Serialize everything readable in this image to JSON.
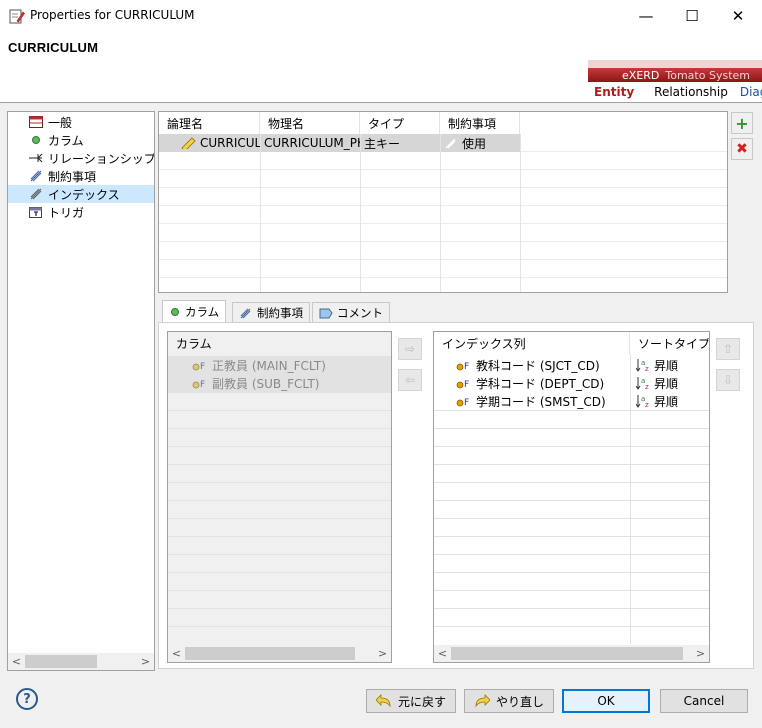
{
  "window": {
    "title": "Properties for CURRICULUM",
    "minimize": "—",
    "maximize": "☐",
    "close": "✕"
  },
  "header": {
    "entity_title": "CURRICULUM",
    "banner": {
      "brand": "eXERD",
      "subtitle": "Tomato System",
      "tabs": {
        "entity": "Entity",
        "relationship": "Relationship",
        "diagram": "Diag"
      }
    }
  },
  "tree": {
    "items": [
      {
        "label": "一般",
        "icon": "table-icon"
      },
      {
        "label": "カラム",
        "icon": "column-dot-icon"
      },
      {
        "label": "リレーションシップ",
        "icon": "relationship-arrow-icon"
      },
      {
        "label": "制約事項",
        "icon": "constraint-icon"
      },
      {
        "label": "インデックス",
        "icon": "index-icon",
        "selected": true
      },
      {
        "label": "トリガ",
        "icon": "trigger-icon"
      }
    ],
    "scroll_left": "<",
    "scroll_right": ">"
  },
  "index_table": {
    "headers": [
      "論理名",
      "物理名",
      "タイプ",
      "制約事項"
    ],
    "rows": [
      {
        "logical": "CURRICULUM_PK",
        "physical": "CURRICULUM_PK",
        "type": "主キー",
        "constraint": "使用"
      }
    ]
  },
  "side_buttons": {
    "add": "+",
    "delete": "✖"
  },
  "tabs": [
    {
      "label": "カラム",
      "icon": "column-dot-icon",
      "active": true
    },
    {
      "label": "制約事項",
      "icon": "constraint-icon"
    },
    {
      "label": "コメント",
      "icon": "comment-icon"
    }
  ],
  "columns_panel": {
    "header": "カラム",
    "items": [
      "正教員 (MAIN_FCLT)",
      "副教員 (SUB_FCLT)"
    ]
  },
  "move_buttons": {
    "add": "⇨",
    "remove": "⇦"
  },
  "index_columns_panel": {
    "headers": [
      "インデックス列",
      "ソートタイプ"
    ],
    "rows": [
      {
        "column": "教科コード (SJCT_CD)",
        "sort": "昇順"
      },
      {
        "column": "学科コード (DEPT_CD)",
        "sort": "昇順"
      },
      {
        "column": "学期コード (SMST_CD)",
        "sort": "昇順"
      }
    ]
  },
  "order_buttons": {
    "up": "⇧",
    "down": "⇩"
  },
  "footer": {
    "help": "?",
    "restore": "元に戻す",
    "redo": "やり直し",
    "ok": "OK",
    "cancel": "Cancel"
  },
  "colors": {
    "accent": "#0078d7",
    "banner_red": "#b01c1c",
    "selection": "#cce8ff"
  }
}
